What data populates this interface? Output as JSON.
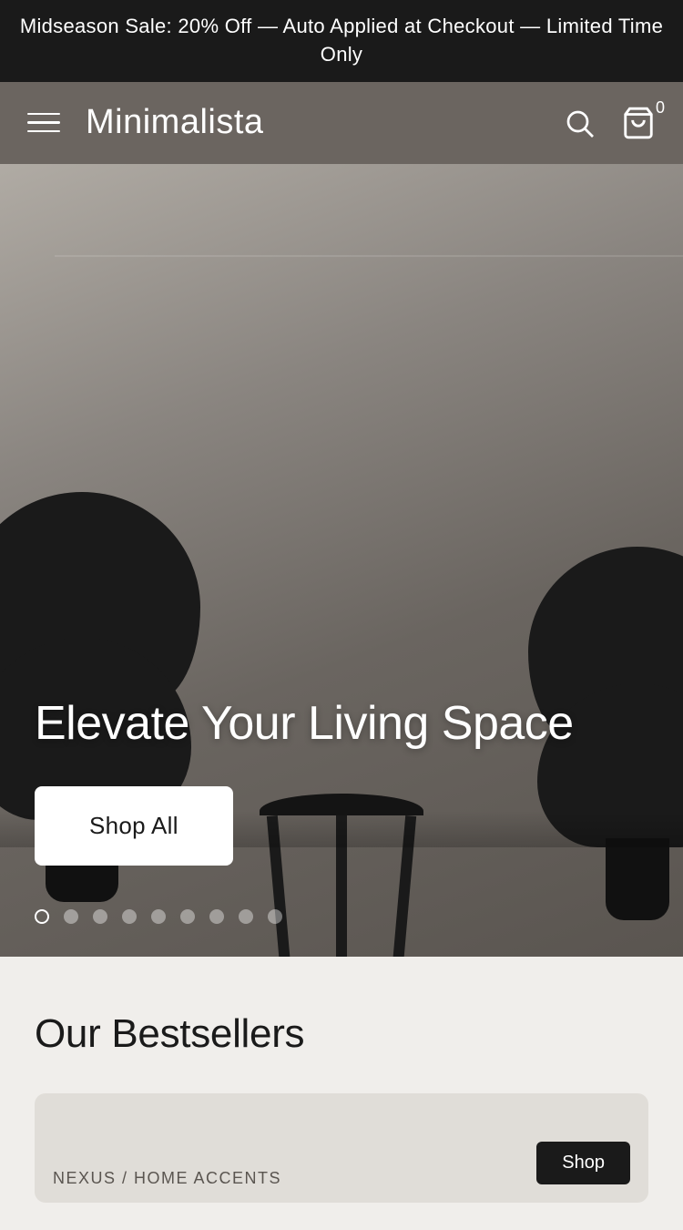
{
  "announcement": {
    "text": "Midseason Sale: 20% Off — Auto Applied at Checkout — Limited Time Only"
  },
  "header": {
    "brand": "Minimalista",
    "cart_count": "0"
  },
  "hero": {
    "headline": "Elevate Your Living Space",
    "cta_label": "Shop All"
  },
  "carousel": {
    "total_dots": 9,
    "active_dot": 0
  },
  "bestsellers": {
    "section_title": "Our Bestsellers",
    "product_label": "NEXUS / HOME ACCENTS",
    "product_btn": "Shop"
  }
}
